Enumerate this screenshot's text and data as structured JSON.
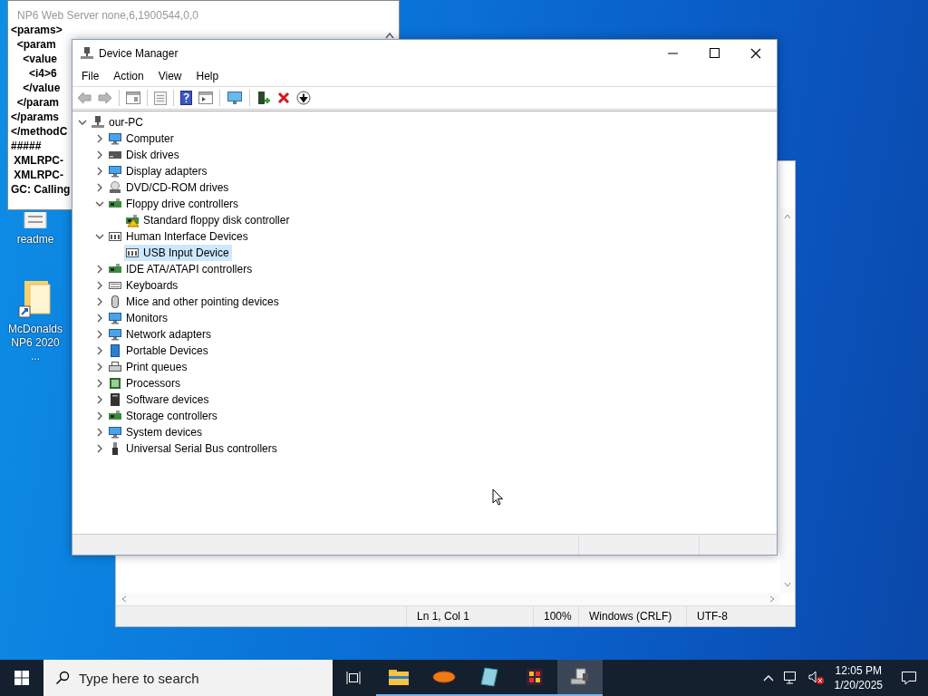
{
  "console_window": {
    "title": "NP6 Web Server none,6,1900544,0,0",
    "lines": [
      "<params>",
      "  <param",
      "    <value",
      "      <i4>6",
      "    </value",
      "  </param",
      "</params",
      "</methodC",
      "#####",
      " XMLRPC-",
      " XMLRPC-",
      "GC: Calling"
    ]
  },
  "desktop_icons": [
    {
      "label": "readme"
    },
    {
      "label": "McDonalds NP6 2020 ..."
    }
  ],
  "notepad": {
    "status_bar": [
      "Ln 1, Col 1",
      "100%",
      "Windows (CRLF)",
      "UTF-8"
    ]
  },
  "device_manager": {
    "title": "Device Manager",
    "menu": [
      "File",
      "Action",
      "View",
      "Help"
    ],
    "tree": {
      "label": "our-PC",
      "expanded": true,
      "selected": false,
      "children": [
        {
          "label": "Computer",
          "expanded": false,
          "selected": false
        },
        {
          "label": "Disk drives",
          "expanded": false,
          "selected": false
        },
        {
          "label": "Display adapters",
          "expanded": false,
          "selected": false
        },
        {
          "label": "DVD/CD-ROM drives",
          "expanded": false,
          "selected": false
        },
        {
          "label": "Floppy drive controllers",
          "expanded": true,
          "selected": false,
          "children": [
            {
              "label": "Standard floppy disk controller",
              "selected": false,
              "warning": true
            }
          ]
        },
        {
          "label": "Human Interface Devices",
          "expanded": true,
          "selected": false,
          "children": [
            {
              "label": "USB Input Device",
              "selected": true,
              "warning": false
            }
          ]
        },
        {
          "label": "IDE ATA/ATAPI controllers",
          "expanded": false,
          "selected": false
        },
        {
          "label": "Keyboards",
          "expanded": false,
          "selected": false
        },
        {
          "label": "Mice and other pointing devices",
          "expanded": false,
          "selected": false
        },
        {
          "label": "Monitors",
          "expanded": false,
          "selected": false
        },
        {
          "label": "Network adapters",
          "expanded": false,
          "selected": false
        },
        {
          "label": "Portable Devices",
          "expanded": false,
          "selected": false
        },
        {
          "label": "Print queues",
          "expanded": false,
          "selected": false
        },
        {
          "label": "Processors",
          "expanded": false,
          "selected": false
        },
        {
          "label": "Software devices",
          "expanded": false,
          "selected": false
        },
        {
          "label": "Storage controllers",
          "expanded": false,
          "selected": false
        },
        {
          "label": "System devices",
          "expanded": false,
          "selected": false
        },
        {
          "label": "Universal Serial Bus controllers",
          "expanded": false,
          "selected": false
        }
      ]
    }
  },
  "taskbar": {
    "search_placeholder": "Type here to search",
    "apps": [
      {
        "selected": false
      },
      {
        "selected": false
      },
      {
        "selected": false
      },
      {
        "selected": false
      },
      {
        "selected": true
      }
    ],
    "clock": {
      "time": "12:05 PM",
      "date": "1/20/2025"
    }
  }
}
